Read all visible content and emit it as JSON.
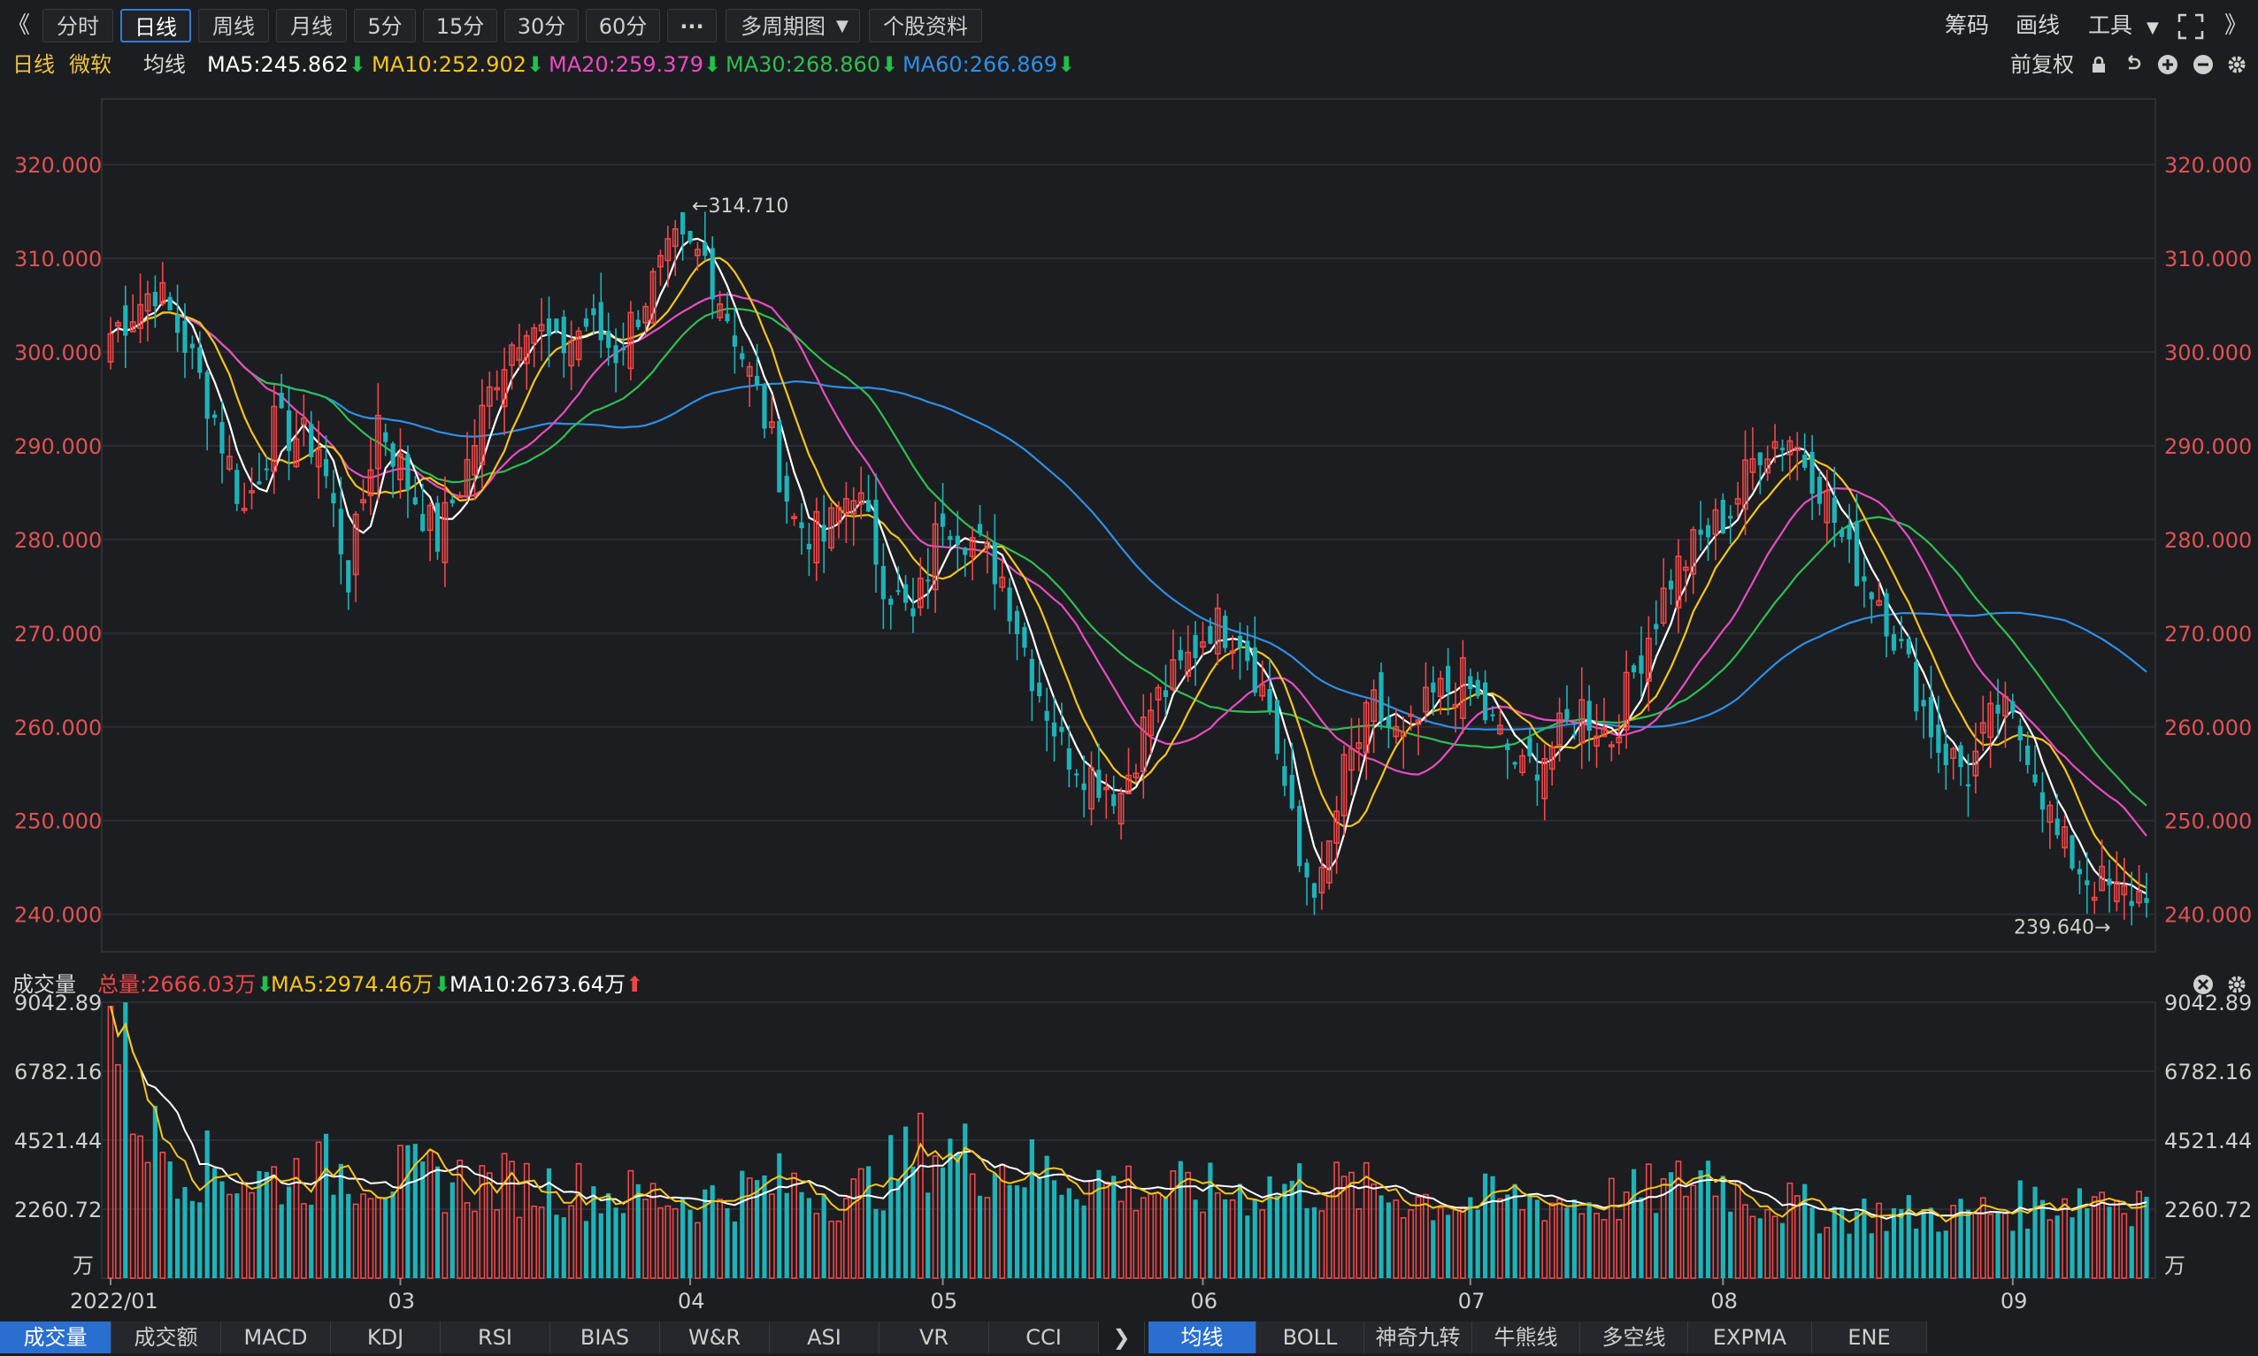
{
  "toolbar": {
    "nav_left_glyph": "《",
    "nav_right_glyph": "》",
    "periods": [
      "分时",
      "日线",
      "周线",
      "月线",
      "5分",
      "15分",
      "30分",
      "60分"
    ],
    "active_period": "日线",
    "more_glyph": "···",
    "multi_period": "多周期图",
    "stock_info": "个股资料",
    "right": [
      "筹码",
      "画线",
      "工具"
    ]
  },
  "legend": {
    "period": "日线",
    "stock": "微软",
    "line_type": "均线",
    "ma5": "MA5:245.862",
    "ma10": "MA10:252.902",
    "ma20": "MA20:259.379",
    "ma30": "MA30:268.860",
    "ma60": "MA60:266.869",
    "adjust": "前复权"
  },
  "volume_legend": {
    "label": "成交量",
    "total": "总量:2666.03万",
    "ma5": "MA5:2974.46万",
    "ma10": "MA10:2673.64万"
  },
  "colors": {
    "up": "#f04848",
    "down": "#1db3b8",
    "ma5": "#ffffff",
    "ma10": "#f5c518",
    "ma20": "#e84cc1",
    "ma30": "#2fbf4f",
    "ma60": "#2d8fe8"
  },
  "chart_data": {
    "type": "candlestick",
    "price_axis": {
      "ticks": [
        240,
        250,
        260,
        270,
        280,
        290,
        300,
        310,
        320
      ],
      "tick_labels": [
        "240.000",
        "250.000",
        "260.000",
        "270.000",
        "280.000",
        "290.000",
        "300.000",
        "310.000",
        "320.000"
      ],
      "range": [
        236,
        327
      ]
    },
    "volume_axis": {
      "ticks": [
        2260.72,
        4521.44,
        6782.16,
        9042.89
      ],
      "tick_labels": [
        "2260.72",
        "4521.44",
        "6782.16",
        "9042.89"
      ],
      "unit": "万",
      "range": [
        0,
        9042.89
      ]
    },
    "x_labels": [
      {
        "label": "2022/01",
        "index": 0
      },
      {
        "label": "03",
        "index": 39
      },
      {
        "label": "04",
        "index": 78
      },
      {
        "label": "05",
        "index": 112
      },
      {
        "label": "06",
        "index": 147
      },
      {
        "label": "07",
        "index": 183
      },
      {
        "label": "08",
        "index": 217
      },
      {
        "label": "09",
        "index": 256
      }
    ],
    "annotations": [
      {
        "label": "←314.710",
        "index": 78,
        "value": 314.71
      },
      {
        "label": "239.640→",
        "index": 274,
        "value": 239.64
      }
    ],
    "close_anchors": [
      [
        0,
        302
      ],
      [
        6,
        307
      ],
      [
        10,
        301
      ],
      [
        14,
        293
      ],
      [
        18,
        283
      ],
      [
        22,
        292
      ],
      [
        28,
        290
      ],
      [
        32,
        276
      ],
      [
        36,
        293
      ],
      [
        40,
        286
      ],
      [
        44,
        280
      ],
      [
        48,
        288
      ],
      [
        52,
        298
      ],
      [
        56,
        304
      ],
      [
        60,
        300
      ],
      [
        64,
        303
      ],
      [
        68,
        300
      ],
      [
        72,
        306
      ],
      [
        76,
        311
      ],
      [
        80,
        310
      ],
      [
        84,
        302
      ],
      [
        88,
        293
      ],
      [
        92,
        282
      ],
      [
        96,
        280
      ],
      [
        100,
        286
      ],
      [
        104,
        276
      ],
      [
        108,
        271
      ],
      [
        112,
        283
      ],
      [
        116,
        280
      ],
      [
        120,
        276
      ],
      [
        124,
        266
      ],
      [
        128,
        258
      ],
      [
        132,
        255
      ],
      [
        136,
        253
      ],
      [
        140,
        262
      ],
      [
        144,
        266
      ],
      [
        148,
        271
      ],
      [
        152,
        270
      ],
      [
        156,
        262
      ],
      [
        160,
        245
      ],
      [
        163,
        243
      ],
      [
        166,
        255
      ],
      [
        170,
        262
      ],
      [
        174,
        258
      ],
      [
        178,
        263
      ],
      [
        182,
        265
      ],
      [
        186,
        260
      ],
      [
        190,
        255
      ],
      [
        194,
        258
      ],
      [
        198,
        262
      ],
      [
        202,
        259
      ],
      [
        206,
        268
      ],
      [
        210,
        276
      ],
      [
        214,
        280
      ],
      [
        218,
        283
      ],
      [
        222,
        290
      ],
      [
        226,
        291
      ],
      [
        230,
        286
      ],
      [
        234,
        278
      ],
      [
        238,
        274
      ],
      [
        242,
        266
      ],
      [
        246,
        258
      ],
      [
        250,
        255
      ],
      [
        254,
        262
      ],
      [
        258,
        258
      ],
      [
        262,
        248
      ],
      [
        266,
        244
      ],
      [
        270,
        242
      ]
    ],
    "volume_anchors": [
      [
        0,
        9000
      ],
      [
        3,
        6000
      ],
      [
        6,
        4500
      ],
      [
        10,
        3800
      ],
      [
        20,
        3200
      ],
      [
        30,
        3600
      ],
      [
        40,
        3300
      ],
      [
        50,
        3100
      ],
      [
        60,
        3000
      ],
      [
        70,
        2700
      ],
      [
        80,
        2600
      ],
      [
        90,
        3100
      ],
      [
        100,
        2700
      ],
      [
        105,
        3500
      ],
      [
        110,
        4300
      ],
      [
        120,
        3700
      ],
      [
        130,
        3300
      ],
      [
        140,
        2900
      ],
      [
        150,
        2800
      ],
      [
        160,
        3100
      ],
      [
        170,
        2800
      ],
      [
        180,
        2500
      ],
      [
        190,
        2600
      ],
      [
        200,
        2500
      ],
      [
        210,
        2900
      ],
      [
        215,
        3600
      ],
      [
        220,
        2700
      ],
      [
        230,
        2200
      ],
      [
        240,
        2100
      ],
      [
        250,
        2100
      ],
      [
        260,
        2500
      ],
      [
        268,
        2800
      ],
      [
        270,
        2600
      ]
    ],
    "ma_end_values": {
      "MA5": 245.862,
      "MA10": 252.902,
      "MA20": 259.379,
      "MA30": 268.86,
      "MA60": 266.869
    },
    "ma_vol_end_values": {
      "MA5": 2974.46,
      "MA10": 2673.64
    },
    "last_volume": 2666.03
  },
  "bottom_tabs": {
    "left": [
      "成交量",
      "成交额",
      "MACD",
      "KDJ",
      "RSI",
      "BIAS",
      "W&R",
      "ASI",
      "VR",
      "CCI"
    ],
    "left_active": "成交量",
    "next_glyph": "❯",
    "right": [
      "均线",
      "BOLL",
      "神奇九转",
      "牛熊线",
      "多空线",
      "EXPMA",
      "ENE"
    ],
    "right_active": "均线"
  }
}
